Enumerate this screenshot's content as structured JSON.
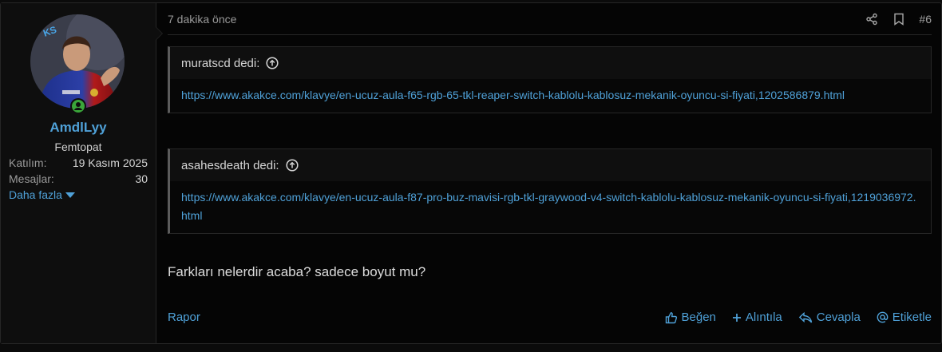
{
  "user": {
    "username": "AmdlLyy",
    "title": "Femtopat",
    "stats": [
      {
        "label": "Katılım:",
        "value": "19 Kasım 2025"
      },
      {
        "label": "Mesajlar:",
        "value": "30"
      }
    ],
    "more_label": "Daha fazla"
  },
  "post": {
    "timestamp": "7 dakika önce",
    "number": "#6",
    "quotes": [
      {
        "author": "muratscd dedi:",
        "link": "https://www.akakce.com/klavye/en-ucuz-aula-f65-rgb-65-tkl-reaper-switch-kablolu-kablosuz-mekanik-oyuncu-si-fiyati,1202586879.html"
      },
      {
        "author": "asahesdeath dedi:",
        "link": "https://www.akakce.com/klavye/en-ucuz-aula-f87-pro-buz-mavisi-rgb-tkl-graywood-v4-switch-kablolu-kablosuz-mekanik-oyuncu-si-fiyati,1219036972.html"
      }
    ],
    "message": "Farkları nelerdir acaba? sadece boyut mu?"
  },
  "footer": {
    "report": "Rapor",
    "like": "Beğen",
    "quote": "Alıntıla",
    "reply": "Cevapla",
    "tag": "Etiketle"
  },
  "colors": {
    "link": "#4fa1d8",
    "background": "#050505",
    "panel": "#0e0e0e",
    "online": "#3aa63a"
  },
  "icons": [
    "share-icon",
    "bookmark-icon",
    "arrow-up-circle-icon",
    "thumbs-up-icon",
    "plus-icon",
    "reply-icon",
    "at-icon",
    "online-icon",
    "caret-down-icon"
  ]
}
